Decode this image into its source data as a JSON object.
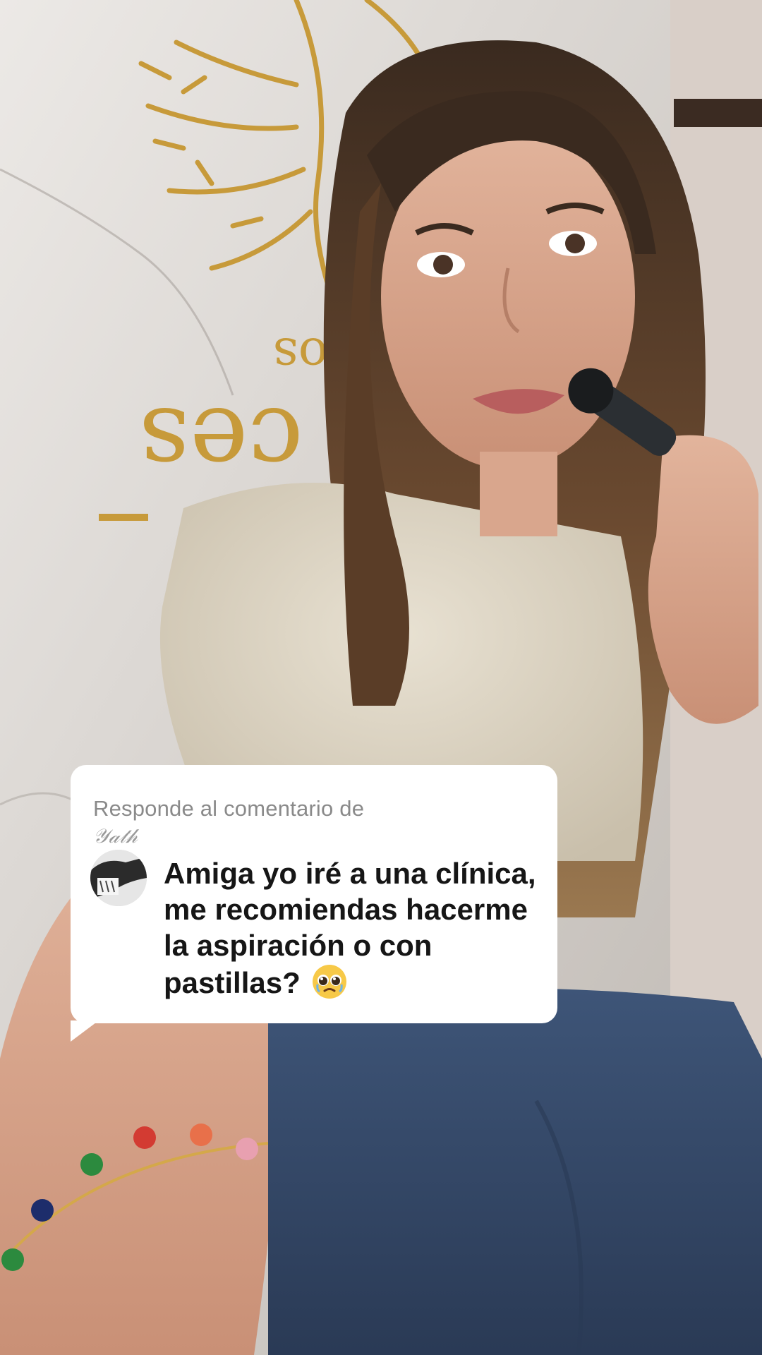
{
  "reply_sticker": {
    "header": "Responde al comentario de",
    "username": "𝒴𝒶𝓉𝒽",
    "comment_text": "Amiga yo iré a una clínica, me recomiendas hacerme la aspiración o con pastillas?",
    "emoji_icon": "pleading-face-icon",
    "avatar_icon": "user-avatar-icon"
  },
  "colors": {
    "card_background": "#ffffff",
    "header_text": "#8a8a8a",
    "comment_text": "#161616"
  }
}
